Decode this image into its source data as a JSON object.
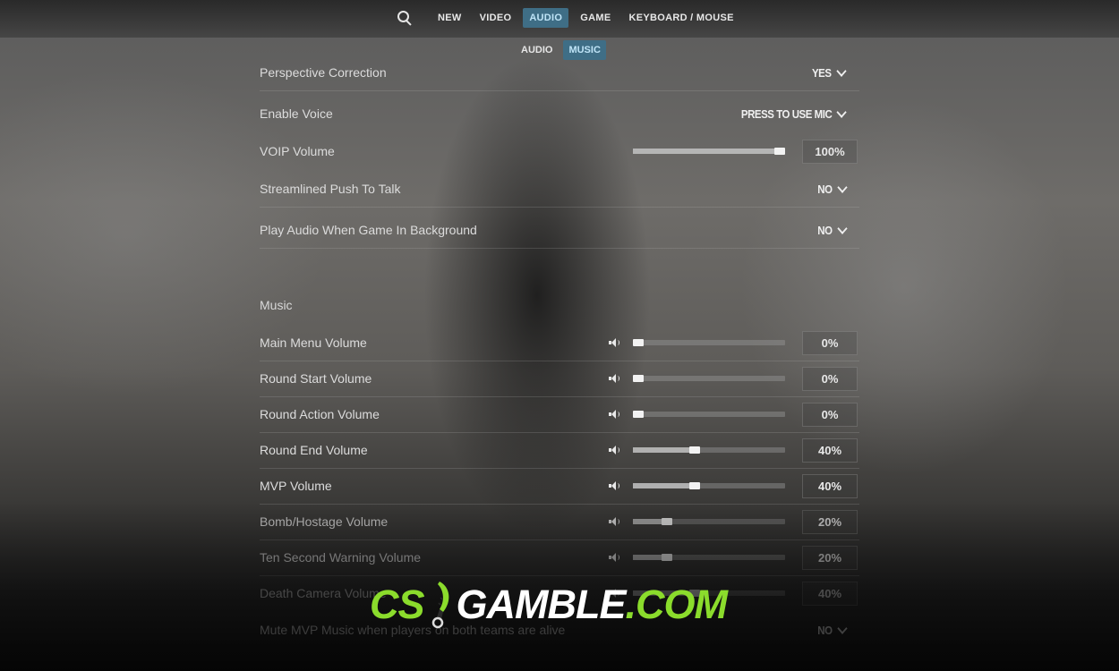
{
  "nav": {
    "tabs": [
      {
        "label": "NEW",
        "active": false
      },
      {
        "label": "VIDEO",
        "active": false
      },
      {
        "label": "AUDIO",
        "active": true
      },
      {
        "label": "GAME",
        "active": false
      },
      {
        "label": "KEYBOARD / MOUSE",
        "active": false
      }
    ],
    "subtabs": [
      {
        "label": "AUDIO",
        "active": false
      },
      {
        "label": "MUSIC",
        "active": true
      }
    ]
  },
  "settings": {
    "perspective": {
      "label": "Perspective Correction",
      "value": "YES"
    },
    "enable_voice": {
      "label": "Enable Voice",
      "value": "PRESS TO USE MIC"
    },
    "voip": {
      "label": "VOIP Volume",
      "value": "100%",
      "level": 1.0
    },
    "push_to_talk": {
      "label": "Streamlined Push To Talk",
      "value": "NO"
    },
    "bg_audio": {
      "label": "Play Audio When Game In Background",
      "value": "NO"
    }
  },
  "music": {
    "section_title": "Music",
    "rows": [
      {
        "label": "Main Menu Volume",
        "value": "0%",
        "level": 0.0
      },
      {
        "label": "Round Start Volume",
        "value": "0%",
        "level": 0.0
      },
      {
        "label": "Round Action Volume",
        "value": "0%",
        "level": 0.0
      },
      {
        "label": "Round End Volume",
        "value": "40%",
        "level": 0.4
      },
      {
        "label": "MVP Volume",
        "value": "40%",
        "level": 0.4
      },
      {
        "label": "Bomb/Hostage Volume",
        "value": "20%",
        "level": 0.2
      },
      {
        "label": "Ten Second Warning Volume",
        "value": "20%",
        "level": 0.2
      },
      {
        "label": "Death Camera Volume",
        "value": "40%",
        "level": 0.4
      }
    ],
    "mute_mvp": {
      "label": "Mute MVP Music when players on both teams are alive",
      "value": "NO"
    }
  },
  "watermark": {
    "prefix": "CS",
    "brand": "GAMBLE",
    "suffix": ".COM"
  },
  "colors": {
    "accent": "#3f6e86",
    "accent_text": "#bfe4f7",
    "brand_green": "#8bdc2c"
  }
}
